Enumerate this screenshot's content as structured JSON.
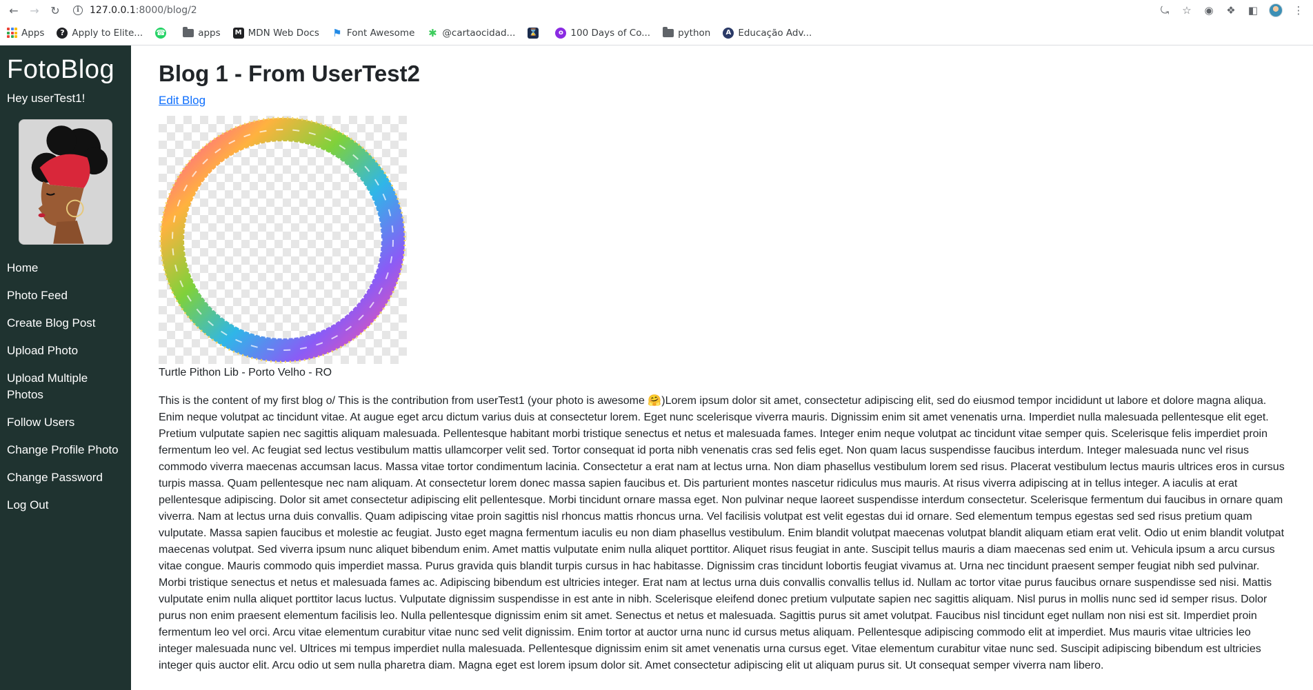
{
  "browser": {
    "url_host": "127.0.0.1",
    "url_path": ":8000/blog/2",
    "bookmarks": [
      {
        "label": "Apps",
        "icon": "apps-grid-icon"
      },
      {
        "label": "Apply to Elite...",
        "icon": "elite-icon"
      },
      {
        "label": "",
        "icon": "whatsapp-icon"
      },
      {
        "label": "apps",
        "icon": "folder-icon"
      },
      {
        "label": "MDN Web Docs",
        "icon": "mdn-icon"
      },
      {
        "label": "Font Awesome",
        "icon": "flag-icon"
      },
      {
        "label": "@cartaocidad...",
        "icon": "asterisk-icon"
      },
      {
        "label": "",
        "icon": "hourglass-icon"
      },
      {
        "label": "100 Days of Co...",
        "icon": "codapi-icon"
      },
      {
        "label": "python",
        "icon": "folder-icon"
      },
      {
        "label": "Educação Adv...",
        "icon": "edu-icon"
      }
    ]
  },
  "sidebar": {
    "brand": "FotoBlog",
    "greeting": "Hey userTest1!",
    "menu": [
      "Home",
      "Photo Feed",
      "Create Blog Post",
      "Upload Photo",
      "Upload Multiple Photos",
      "Follow Users",
      "Change Profile Photo",
      "Change Password",
      "Log Out"
    ]
  },
  "main": {
    "title": "Blog 1 - From UserTest2",
    "edit_link": "Edit Blog",
    "photo_caption": "Turtle Pithon Lib - Porto Velho - RO",
    "content": "This is the content of my first blog o/ This is the contribution from userTest1 (your photo is awesome 🤗)Lorem ipsum dolor sit amet, consectetur adipiscing elit, sed do eiusmod tempor incididunt ut labore et dolore magna aliqua. Enim neque volutpat ac tincidunt vitae. At augue eget arcu dictum varius duis at consectetur lorem. Eget nunc scelerisque viverra mauris. Dignissim enim sit amet venenatis urna. Imperdiet nulla malesuada pellentesque elit eget. Pretium vulputate sapien nec sagittis aliquam malesuada. Pellentesque habitant morbi tristique senectus et netus et malesuada fames. Integer enim neque volutpat ac tincidunt vitae semper quis. Scelerisque felis imperdiet proin fermentum leo vel. Ac feugiat sed lectus vestibulum mattis ullamcorper velit sed. Tortor consequat id porta nibh venenatis cras sed felis eget. Non quam lacus suspendisse faucibus interdum. Integer malesuada nunc vel risus commodo viverra maecenas accumsan lacus. Massa vitae tortor condimentum lacinia. Consectetur a erat nam at lectus urna. Non diam phasellus vestibulum lorem sed risus. Placerat vestibulum lectus mauris ultrices eros in cursus turpis massa. Quam pellentesque nec nam aliquam. At consectetur lorem donec massa sapien faucibus et. Dis parturient montes nascetur ridiculus mus mauris. At risus viverra adipiscing at in tellus integer. A iaculis at erat pellentesque adipiscing. Dolor sit amet consectetur adipiscing elit pellentesque. Morbi tincidunt ornare massa eget. Non pulvinar neque laoreet suspendisse interdum consectetur. Scelerisque fermentum dui faucibus in ornare quam viverra. Nam at lectus urna duis convallis. Quam adipiscing vitae proin sagittis nisl rhoncus mattis rhoncus urna. Vel facilisis volutpat est velit egestas dui id ornare. Sed elementum tempus egestas sed sed risus pretium quam vulputate. Massa sapien faucibus et molestie ac feugiat. Justo eget magna fermentum iaculis eu non diam phasellus vestibulum. Enim blandit volutpat maecenas volutpat blandit aliquam etiam erat velit. Odio ut enim blandit volutpat maecenas volutpat. Sed viverra ipsum nunc aliquet bibendum enim. Amet mattis vulputate enim nulla aliquet porttitor. Aliquet risus feugiat in ante. Suscipit tellus mauris a diam maecenas sed enim ut. Vehicula ipsum a arcu cursus vitae congue. Mauris commodo quis imperdiet massa. Purus gravida quis blandit turpis cursus in hac habitasse. Dignissim cras tincidunt lobortis feugiat vivamus at. Urna nec tincidunt praesent semper feugiat nibh sed pulvinar. Morbi tristique senectus et netus et malesuada fames ac. Adipiscing bibendum est ultricies integer. Erat nam at lectus urna duis convallis convallis tellus id. Nullam ac tortor vitae purus faucibus ornare suspendisse sed nisi. Mattis vulputate enim nulla aliquet porttitor lacus luctus. Vulputate dignissim suspendisse in est ante in nibh. Scelerisque eleifend donec pretium vulputate sapien nec sagittis aliquam. Nisl purus in mollis nunc sed id semper risus. Dolor purus non enim praesent elementum facilisis leo. Nulla pellentesque dignissim enim sit amet. Senectus et netus et malesuada. Sagittis purus sit amet volutpat. Faucibus nisl tincidunt eget nullam non nisi est sit. Imperdiet proin fermentum leo vel orci. Arcu vitae elementum curabitur vitae nunc sed velit dignissim. Enim tortor at auctor urna nunc id cursus metus aliquam. Pellentesque adipiscing commodo elit at imperdiet. Mus mauris vitae ultricies leo integer malesuada nunc vel. Ultrices mi tempus imperdiet nulla malesuada. Pellentesque dignissim enim sit amet venenatis urna cursus eget. Vitae elementum curabitur vitae nunc sed. Suscipit adipiscing bibendum est ultricies integer quis auctor elit. Arcu odio ut sem nulla pharetra diam. Magna eget est lorem ipsum dolor sit. Amet consectetur adipiscing elit ut aliquam purus sit. Ut consequat semper viverra nam libero."
  },
  "colors": {
    "sidebar_bg": "#1f3330",
    "link": "#0d6efd"
  }
}
